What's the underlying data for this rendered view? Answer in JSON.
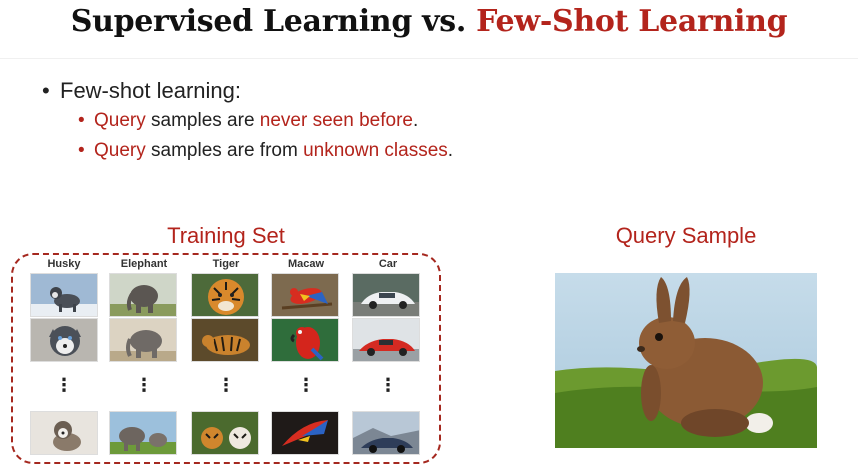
{
  "title": {
    "part1": "Supervised Learning vs. ",
    "part2": "Few-Shot Learning"
  },
  "bullets": {
    "main": "Few-shot learning:",
    "sub1": {
      "a": "Query",
      "b": " samples are ",
      "c": "never seen before",
      "d": "."
    },
    "sub2": {
      "a": "Query",
      "b": " samples are from ",
      "c": "unknown classes",
      "d": "."
    }
  },
  "training_set": {
    "label": "Training Set",
    "classes": [
      "Husky",
      "Elephant",
      "Tiger",
      "Macaw",
      "Car"
    ],
    "ellipsis": "⋮"
  },
  "query_sample": {
    "label": "Query Sample",
    "subject": "rabbit-photo"
  },
  "colors": {
    "accent": "#b3241c",
    "text": "#222222"
  }
}
